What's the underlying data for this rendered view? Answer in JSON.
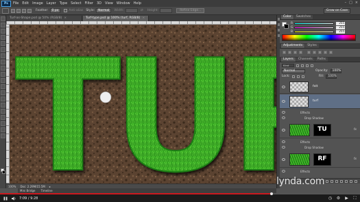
{
  "app": {
    "logo": "Ps",
    "menu": [
      "File",
      "Edit",
      "Image",
      "Layer",
      "Type",
      "Select",
      "Filter",
      "3D",
      "View",
      "Window",
      "Help"
    ],
    "window_controls": [
      "–",
      "□",
      "×"
    ]
  },
  "options_bar": {
    "feather_label": "Feather:",
    "feather_value": "0 px",
    "anti_alias_label": "Anti-alias",
    "style_label": "Style:",
    "style_value": "Normal",
    "width_label": "Width:",
    "height_label": "Height:",
    "refine_edge_label": "Refine Edge...",
    "workspace": "Grow on Case"
  },
  "tabs": [
    {
      "label": "Turf-as-Shape.psd @ 50% (RGB/8)",
      "active": false
    },
    {
      "label": "Turf-type.psd @ 100% (turf, RGB/8)",
      "active": true
    }
  ],
  "canvas": {
    "text": "TURF",
    "colors": {
      "grass_light": "#5fd43a",
      "grass_mid": "#2f9e1e",
      "grass_dark": "#136b0e",
      "soil": "#5b4331",
      "soil_dark": "#3a2a1c"
    }
  },
  "status": {
    "zoom": "100%",
    "doc": "Doc: 2.29M/15.5M"
  },
  "mini_bridge": {
    "tabs": [
      "Mini Bridge",
      "Timeline"
    ]
  },
  "color_panel": {
    "tabs": [
      "Color",
      "Swatches"
    ],
    "channels": [
      {
        "label": "R",
        "value": "255"
      },
      {
        "label": "G",
        "value": "255"
      },
      {
        "label": "B",
        "value": "255"
      }
    ]
  },
  "adjustments_panel": {
    "tabs": [
      "Adjustments",
      "Styles"
    ]
  },
  "layers_panel": {
    "tabs": [
      "Layers",
      "Channels",
      "Paths"
    ],
    "filter_kind": "Kind",
    "blend_mode": "Normal",
    "opacity_label": "Opacity:",
    "opacity_value": "100%",
    "lock_label": "Lock:",
    "fill_label": "Fill:",
    "fill_value": "100%",
    "layers": [
      {
        "name": "felt",
        "type": "checker",
        "effects": []
      },
      {
        "name": "turf",
        "type": "checker",
        "selected": true,
        "effects": [
          "Effects",
          "Drop Shadow"
        ]
      },
      {
        "name": "",
        "mask_text": "TU",
        "type": "grass",
        "effects": [
          "Effects",
          "Drop Shadow"
        ]
      },
      {
        "name": "",
        "mask_text": "RF",
        "type": "grass",
        "effects": [
          "Effects"
        ]
      }
    ],
    "fx_label": "fx"
  },
  "watermark": {
    "text": "lynda",
    "dot": ".",
    "com": "com"
  },
  "player": {
    "current_time": "7:09",
    "total_time": "/ 9:28",
    "progress": 0.755
  }
}
